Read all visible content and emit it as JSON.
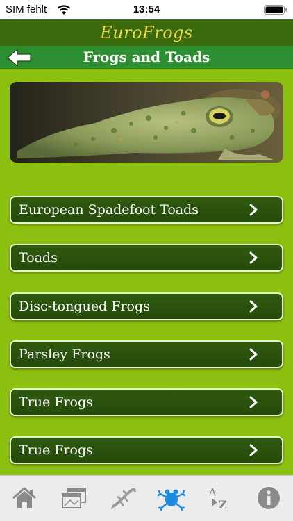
{
  "status_bar": {
    "carrier": "SIM fehlt",
    "time": "13:54"
  },
  "header": {
    "brand": "EuroFrogs",
    "title": "Frogs and Toads"
  },
  "categories": [
    {
      "label": "European Spadefoot Toads"
    },
    {
      "label": "Toads"
    },
    {
      "label": "Disc-tongued Frogs"
    },
    {
      "label": "Parsley Frogs"
    },
    {
      "label": "True Frogs"
    },
    {
      "label": "True Frogs"
    }
  ],
  "tab_bar": {
    "tabs": [
      {
        "icon": "home-icon",
        "active": false
      },
      {
        "icon": "gallery-icon",
        "active": false
      },
      {
        "icon": "lizard-icon",
        "active": false
      },
      {
        "icon": "frog-icon",
        "active": true
      },
      {
        "icon": "az-sort-icon",
        "active": false
      },
      {
        "icon": "info-icon",
        "active": false
      }
    ]
  },
  "colors": {
    "background": "#8cc010",
    "brand_bar": "#3b6a0c",
    "title_bar": "#2e8f32",
    "brand_text": "#e8d84a",
    "button": "#2f5a10",
    "active_tab": "#1a8be0"
  }
}
